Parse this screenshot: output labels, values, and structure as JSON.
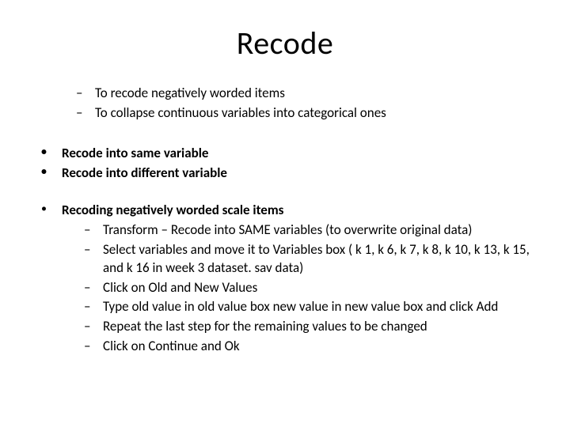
{
  "title": "Recode",
  "intro_dash": [
    "To recode negatively worded items",
    "To collapse continuous variables into categorical ones"
  ],
  "bullets_a": [
    "Recode into same variable",
    "Recode into different variable"
  ],
  "bullet_b_header": "Recoding negatively worded scale items",
  "bullet_b_sub": [
    "Transform   –    Recode into SAME variables (to overwrite original data)",
    "Select variables and move it to Variables box ( k 1, k 6, k 7, k 8, k 10, k 13, k 15, and k 16 in week 3 dataset. sav data)",
    "Click on Old and New Values",
    "Type old value in old value box new value in new value box and click Add",
    "Repeat the last step for the remaining values to be changed",
    "Click on Continue and Ok"
  ]
}
